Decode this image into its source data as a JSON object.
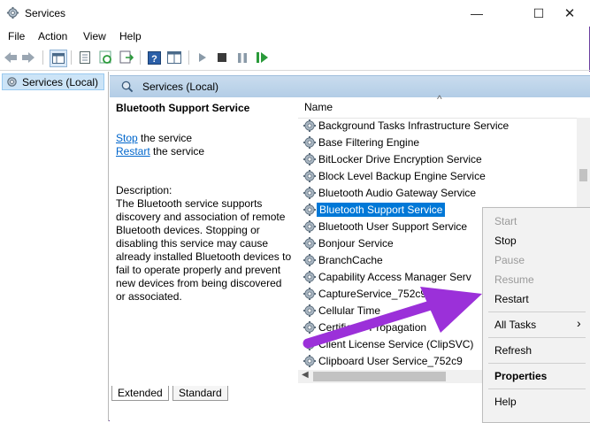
{
  "window": {
    "title": "Services",
    "min": "—",
    "max": "☐",
    "close": "✕"
  },
  "menu": [
    "File",
    "Action",
    "View",
    "Help"
  ],
  "tree": {
    "root": "Services (Local)"
  },
  "pane": {
    "header": "Services (Local)",
    "detail": {
      "title": "Bluetooth Support Service",
      "stop_link": "Stop",
      "stop_suffix": " the service",
      "restart_link": "Restart",
      "restart_suffix": " the service",
      "description_label": "Description:",
      "description": "The Bluetooth service supports discovery and association of remote Bluetooth devices.  Stopping or disabling this service may cause already installed Bluetooth devices to fail to operate properly and prevent new devices from being discovered or associated."
    },
    "list": {
      "column_name": "Name",
      "sort_glyph": "^",
      "rows": [
        "Background Tasks Infrastructure Service",
        "Base Filtering Engine",
        "BitLocker Drive Encryption Service",
        "Block Level Backup Engine Service",
        "Bluetooth Audio Gateway Service",
        "Bluetooth Support Service",
        "Bluetooth User Support Service",
        "Bonjour Service",
        "BranchCache",
        "Capability Access Manager Serv",
        "CaptureService_752c9",
        "Cellular Time",
        "Certificate Propagation",
        "Client License Service (ClipSVC)",
        "Clipboard User Service_752c9"
      ],
      "selected_index": 5
    },
    "tabs": [
      "Extended",
      "Standard"
    ]
  },
  "context_menu": {
    "start": "Start",
    "stop": "Stop",
    "pause": "Pause",
    "resume": "Resume",
    "restart": "Restart",
    "all_tasks": "All Tasks",
    "all_tasks_arrow": "›",
    "refresh": "Refresh",
    "properties": "Properties",
    "help": "Help"
  },
  "colors": {
    "arrow": "#9b30d9",
    "selection": "#0078d7",
    "link": "#0066cc"
  }
}
